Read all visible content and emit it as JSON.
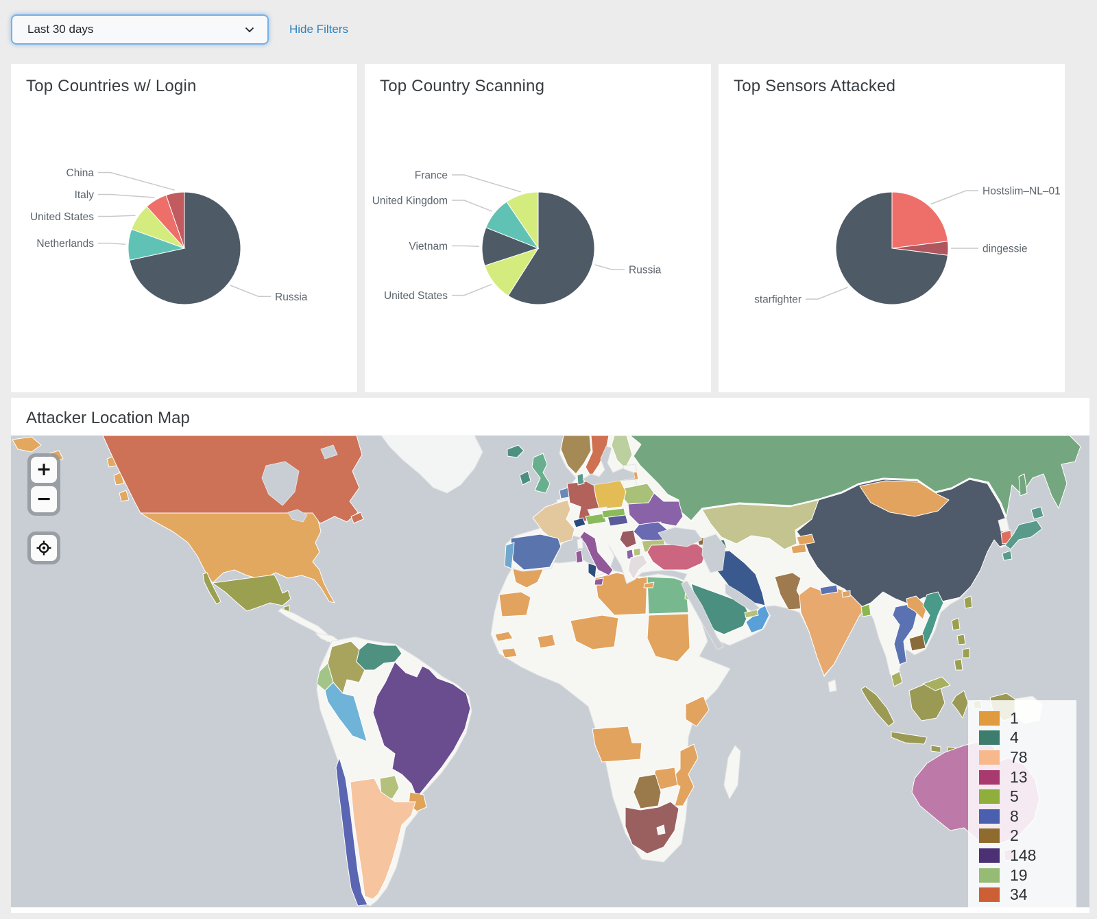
{
  "filters": {
    "time_range": "Last 30 days",
    "hide_filters_label": "Hide Filters"
  },
  "chart_data": [
    {
      "type": "pie",
      "title": "Top Countries w/ Login",
      "legend_position": "callout-labels",
      "slices": [
        {
          "label": "Russia",
          "pct": 71.6,
          "color": "#4e5a65"
        },
        {
          "label": "Netherlands",
          "pct": 8.9,
          "color": "#5fc2b5"
        },
        {
          "label": "United States",
          "pct": 7.8,
          "color": "#d4ec7e"
        },
        {
          "label": "Italy",
          "pct": 6.4,
          "color": "#ee6f6a"
        },
        {
          "label": "China",
          "pct": 5.3,
          "color": "#c15b5f"
        }
      ]
    },
    {
      "type": "pie",
      "title": "Top Country Scanning",
      "legend_position": "callout-labels",
      "slices": [
        {
          "label": "Russia",
          "pct": 59,
          "color": "#4e5a65"
        },
        {
          "label": "United States",
          "pct": 11,
          "color": "#d4ec7e"
        },
        {
          "label": "Vietnam",
          "pct": 11,
          "color": "#4e5a65"
        },
        {
          "label": "United Kingdom",
          "pct": 9.5,
          "color": "#5fc2b5"
        },
        {
          "label": "France",
          "pct": 9.5,
          "color": "#d4ec7e"
        }
      ]
    },
    {
      "type": "pie",
      "title": "Top Sensors Attacked",
      "legend_position": "callout-labels",
      "slices": [
        {
          "label": "Hostslim–NL–01",
          "pct": 23,
          "color": "#ee6f6a"
        },
        {
          "label": "dingessie",
          "pct": 4,
          "color": "#b0565e"
        },
        {
          "label": "starfighter",
          "pct": 73,
          "color": "#4e5a65"
        }
      ]
    },
    {
      "type": "choropleth",
      "title": "Attacker Location Map",
      "ocean_color": "#c9ced4",
      "no_data_color": "#f6f6f3",
      "legend": [
        {
          "value": "1",
          "color": "#e09b3f"
        },
        {
          "value": "4",
          "color": "#3d7d6e"
        },
        {
          "value": "78",
          "color": "#f7b98b"
        },
        {
          "value": "13",
          "color": "#a93a6f"
        },
        {
          "value": "5",
          "color": "#8fae3b"
        },
        {
          "value": "8",
          "color": "#4a5fae"
        },
        {
          "value": "2",
          "color": "#8f6b2d"
        },
        {
          "value": "148",
          "color": "#4b3173"
        },
        {
          "value": "19",
          "color": "#96bb75"
        },
        {
          "value": "34",
          "color": "#cc5f35"
        }
      ],
      "countries": {
        "canada": "#cd7157",
        "alaska": "#e2a85f",
        "usa": "#e2a85f",
        "newfoundland": "#cd7157",
        "mexico": "#9aa050",
        "baja": "#9aa050",
        "belize": "#9aa050",
        "central-america": "#f6f6f3",
        "panama": "#96524a",
        "cuba": "#f6f6f3",
        "hispaniola": "#f6f6f3",
        "dominican": "#8a5050",
        "greenland": "#f3f4f4",
        "sa-base": "#f6f6f3",
        "colombia": "#a8a45e",
        "venezuela": "#4e9181",
        "french-guiana": "#eec189",
        "ecuador": "#a3c487",
        "peru": "#6fb3d9",
        "brazil": "#6a4d8f",
        "paraguay": "#b5c17a",
        "uruguay": "#dfa35a",
        "argentina": "#f6c49e",
        "chile": "#5a66b2",
        "africa-base": "#f6f6f3",
        "morocco": "#e2a35f",
        "tunisia": "#2e4d7b",
        "libya": "#e2a35f",
        "egypt": "#77b88f",
        "mauritania": "#e2a35f",
        "senegal": "#e2a35f",
        "guinea": "#e2a35f",
        "burkina": "#e2a35f",
        "niger": "#e2a35f",
        "sudan": "#e2a35f",
        "kenya": "#e2a35f",
        "angola": "#e2a35f",
        "malawi": "#e2a35f",
        "mozambique": "#e2a35f",
        "zimbabwe": "#e2a35f",
        "botswana": "#9a7a4a",
        "south-africa": "#9a6060",
        "lesotho": "#f6f6f3",
        "madagascar": "#f6f6f3",
        "eurasia-base": "#f6f6f3",
        "russia": "#74a77f",
        "iceland": "#4e9181",
        "ireland": "#4a8f80",
        "uk": "#68b08d",
        "norway": "#a58a55",
        "sweden": "#cf7150",
        "finland": "#bccf9e",
        "denmark": "#5a9a8a",
        "netherlands": "#6a88b8",
        "belgium": "#f6f6f3",
        "germany": "#b2625a",
        "czech": "#f6f6f3",
        "poland": "#e3bc55",
        "france": "#e3c89e",
        "switzerland": "#2a4a7f",
        "austria": "#8aba5a",
        "spain": "#5a74ae",
        "portugal": "#6fa8cc",
        "italy": "#91599a",
        "sicily": "#91599a",
        "sardinia": "#91599a",
        "corsica": "#f6f6f3",
        "estonia": "#f6f6f3",
        "latvia": "#e2a35f",
        "lithuania": "#f6f6f3",
        "belarus": "#a8c078",
        "ukraine": "#8a62a8",
        "moldova": "#b5c17a",
        "hungary": "#5a5a9a",
        "slovakia": "#8aba5a",
        "romania": "#6a6ab2",
        "serbia": "#9a5a5f",
        "albania": "#8a62a8",
        "macedonia": "#b5c17a",
        "bulgaria": "#b5c17a",
        "greece": "#e3dde0",
        "crete": "#e2a35f",
        "turkey": "#cc6680",
        "georgia": "#8a6b3a",
        "azerbaijan": "#3d7d6e",
        "iran": "#3a5a8f",
        "kazakhstan": "#c3c48f",
        "kyrgyzstan": "#e2a35f",
        "tajikistan": "#e2a35f",
        "pakistan": "#a07a4f",
        "india": "#e8a96e",
        "nepal": "#5a72b2",
        "bhutan": "#e2a35f",
        "bangladesh": "#8ab84f",
        "sri-lanka": "#f6f6f3",
        "china": "#4f5a6a",
        "mongolia": "#e2a35f",
        "north-korea": "#f6f6f3",
        "south-korea": "#dd6f5f",
        "japan": "#5a9a8a",
        "sakhalin": "#74a77f",
        "taiwan": "#9aa050",
        "thailand": "#5a72b2",
        "laos": "#e2a35f",
        "vietnam": "#4a9a8a",
        "cambodia": "#8a6b3a",
        "malaysia": "#a8b060",
        "malaysia-borneo": "#a8b060",
        "philippines": "#9aa050",
        "indonesia": "#9a9a55",
        "png-west": "#9a9a55",
        "png": "#f6f6f3",
        "australia": "#bd7aa8",
        "tasmania": "#bd7aa8",
        "saudi": "#4a8f80",
        "oman": "#5aa0d8",
        "uae": "#b5c17a",
        "israel": "#b5c17a"
      }
    }
  ],
  "map_controls": {
    "zoom_in": "+",
    "zoom_out": "−"
  }
}
